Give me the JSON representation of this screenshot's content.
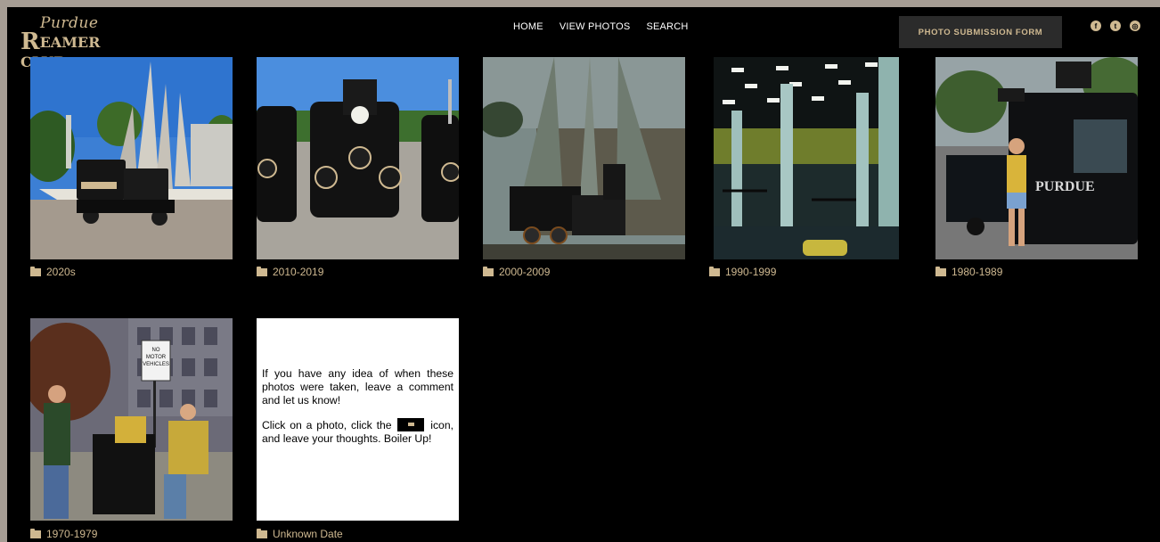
{
  "brand": {
    "script": "Purdue",
    "first_letter": "R",
    "rest": "EAMER",
    "club": "CLUB"
  },
  "nav": {
    "items": [
      "HOME",
      "VIEW PHOTOS",
      "SEARCH"
    ]
  },
  "header": {
    "submit_label": "PHOTO SUBMISSION FORM"
  },
  "social": {
    "icons": [
      "facebook-icon",
      "twitter-icon",
      "instagram-icon"
    ],
    "glyphs": [
      "f",
      "t",
      "◎"
    ]
  },
  "albums": [
    {
      "label": "2020s",
      "image": "Boilermaker Special train at Purdue fountain"
    },
    {
      "label": "2010-2019",
      "image": "Three black train cars on gravel"
    },
    {
      "label": "2000-2009",
      "image": "Train beneath tall white spires at dusk"
    },
    {
      "label": "1990-1999",
      "image": "Weight room with fluorescent lights"
    },
    {
      "label": "1980-1989",
      "image": "Person washing the train"
    },
    {
      "label": "1970-1979",
      "image": "Group posing by No Motor Vehicles sign"
    },
    {
      "label": "Unknown Date",
      "image": ""
    }
  ],
  "note": {
    "p1": "If you have any idea of when these photos were taken, leave a comment and let us know!",
    "p2_before": "Click on a photo, click the",
    "p2_after": "icon, and leave your thoughts. Boiler Up!"
  },
  "sign": {
    "lines": [
      "NO",
      "MOTOR",
      "VEHICLES"
    ]
  },
  "train_text": {
    "purdue": "PURDUE"
  },
  "colors": {
    "gold": "#cfb991",
    "background": "#000000",
    "frame": "#a69d94"
  }
}
